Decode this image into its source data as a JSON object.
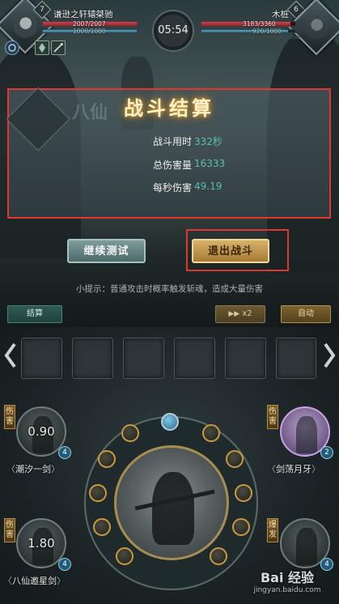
{
  "hud": {
    "player": {
      "level": "7",
      "name": "谦逊之轩辕桀驰",
      "hp": "2007/2007",
      "mp": "1000/1000"
    },
    "enemy": {
      "level": "6",
      "name": "木桩",
      "hp": "3183/3360",
      "mp": "920/1000"
    },
    "timer": "05:54",
    "player_hp_fraction": 1.0,
    "player_mp_fraction": 1.0,
    "enemy_hp_fraction": 0.947,
    "enemy_mp_fraction": 0.92
  },
  "result": {
    "ghost_text": "八仙",
    "title": "战斗结算",
    "stats": [
      {
        "label": "战斗用时",
        "value": "332秒"
      },
      {
        "label": "总伤害量",
        "value": "16333"
      },
      {
        "label": "每秒伤害",
        "value": "49.19"
      }
    ],
    "continue_label": "继续测试",
    "exit_label": "退出战斗"
  },
  "tip": "小提示：普通攻击时概率触发斩魂，造成大量伤害",
  "controls": {
    "settle_label": "结算",
    "speed_label": "x2",
    "auto_label": "自动"
  },
  "skills": {
    "top_left": {
      "tag": "伤害",
      "cooldown": "0.90",
      "count": "4",
      "name": "潮汐一剑"
    },
    "top_right": {
      "tag": "伤害",
      "count": "2",
      "name": "剑荡月牙"
    },
    "bottom_left": {
      "tag": "伤害",
      "cooldown": "1.80",
      "count": "4",
      "name": "八仙邀星剑"
    },
    "bottom_right": {
      "tag": "爆发",
      "count": "4"
    }
  },
  "watermark": {
    "line1": "Bai 经验",
    "line2": "jingyan.baidu.com"
  },
  "colors": {
    "highlight_border": "#e0382e",
    "gold": "#d8b26a",
    "teal_value": "#57bfb2"
  }
}
